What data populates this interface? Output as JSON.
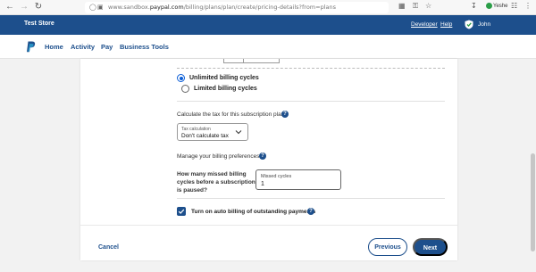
{
  "browser": {
    "url_prefix": "www.sandbox.",
    "url_domain": "paypal.com",
    "url_path": "/billing/plans/plan/create/pricing-details?from=plans",
    "profile_name": "Yeshe"
  },
  "header": {
    "store_name": "Test Store",
    "developer_link": "Developer",
    "help_link": "Help",
    "user_name": "John",
    "bg_color": "#1d4f8c"
  },
  "nav": {
    "items": [
      "Home",
      "Activity",
      "Pay",
      "Business Tools"
    ]
  },
  "billing": {
    "unlimited_label": "Unlimited billing cycles",
    "limited_label": "Limited billing cycles",
    "selected": "unlimited"
  },
  "tax": {
    "section_label": "Calculate the tax for this subscription plan",
    "select_label": "Tax calculation",
    "select_value": "Don't calculate tax"
  },
  "preferences": {
    "section_label": "Manage your billing preferences",
    "missed_question": "How many missed billing cycles before a subscription is paused?",
    "missed_label": "Missed cycles",
    "missed_value": "1",
    "auto_billing_label": "Turn on auto billing of outstanding payments",
    "auto_billing_checked": true
  },
  "footer": {
    "cancel_label": "Cancel",
    "previous_label": "Previous",
    "next_label": "Next"
  }
}
